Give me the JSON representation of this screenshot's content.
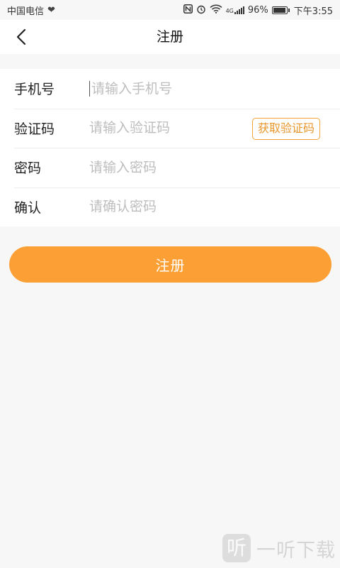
{
  "status_bar": {
    "carrier": "中国电信",
    "network": "4G",
    "battery": "96%",
    "time": "下午3:55",
    "icons": [
      "heart-rate-icon",
      "nfc-icon",
      "alarm-icon",
      "wifi-icon",
      "signal-icon",
      "battery-icon"
    ]
  },
  "nav": {
    "title": "注册",
    "back_icon": "chevron-left-icon"
  },
  "form": {
    "phone": {
      "label": "手机号",
      "placeholder": "请输入手机号",
      "value": ""
    },
    "code": {
      "label": "验证码",
      "placeholder": "请输入验证码",
      "value": "",
      "button_label": "获取验证码"
    },
    "password": {
      "label": "密码",
      "placeholder": "请输入密码",
      "value": ""
    },
    "confirm": {
      "label": "确认",
      "placeholder": "请确认密码",
      "value": ""
    }
  },
  "register_button": {
    "label": "注册"
  },
  "watermark": {
    "logo_text": "听",
    "text": "一听下载"
  },
  "colors": {
    "accent": "#fca036",
    "code_button_border": "#f2a23a",
    "code_button_text": "#e8962c",
    "placeholder": "#bdbdbd",
    "background": "#f7f7f7"
  }
}
